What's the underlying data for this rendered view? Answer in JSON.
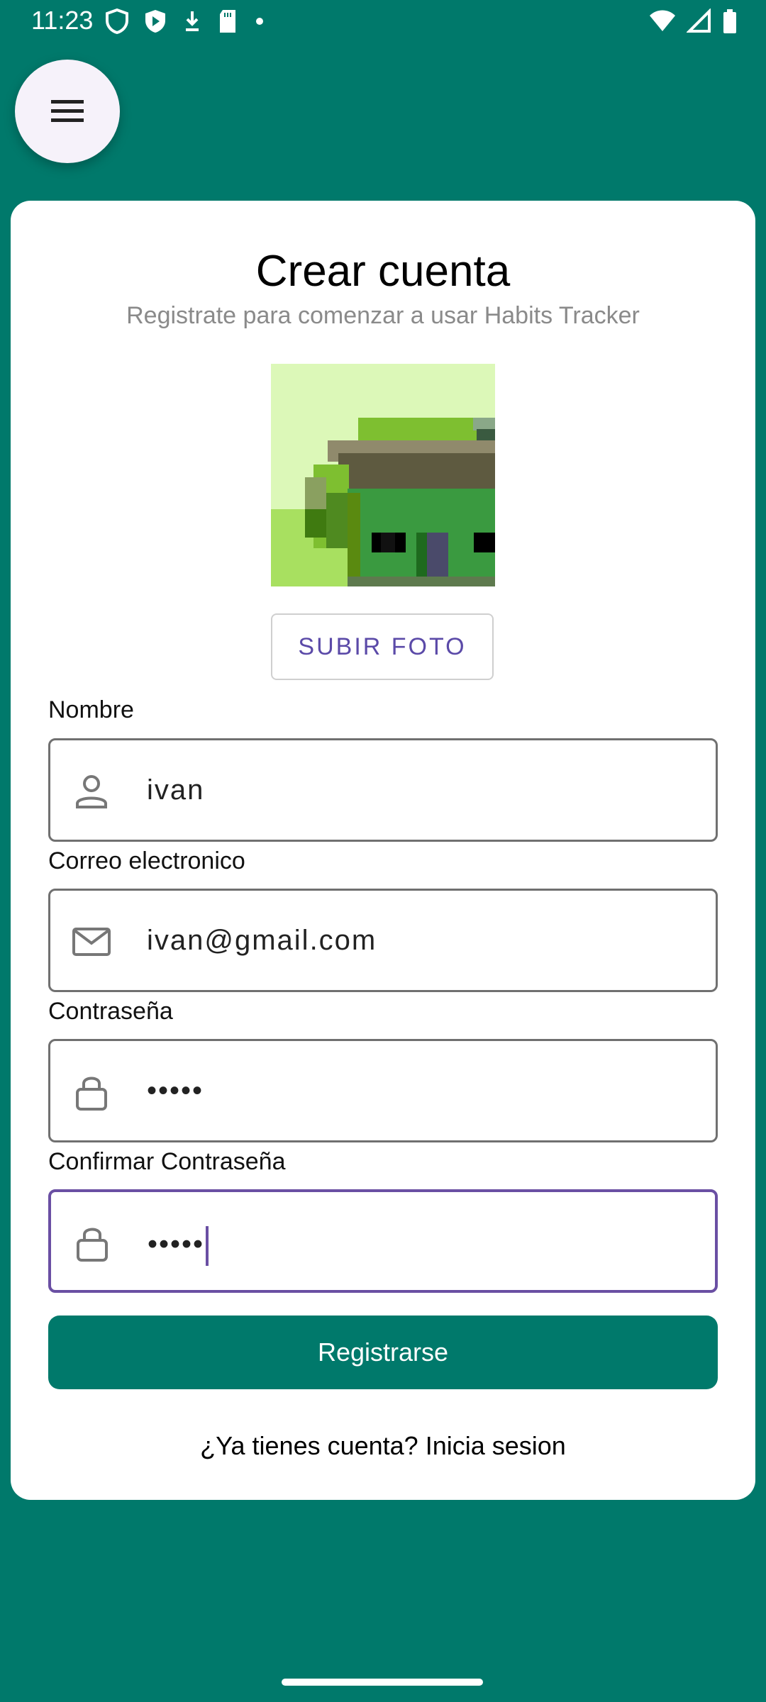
{
  "status_bar": {
    "time": "11:23",
    "left_icons": [
      "shield-icon",
      "play-protect-icon",
      "download-icon",
      "sd-card-icon",
      "dot-icon"
    ],
    "right_icons": [
      "wifi-icon",
      "signal-icon",
      "battery-icon"
    ]
  },
  "menu": {
    "icon": "hamburger-menu-icon"
  },
  "header": {
    "title": "Crear cuenta",
    "subtitle": "Registrate para comenzar a usar Habits Tracker"
  },
  "avatar": {
    "description_icon": "pixel-avatar"
  },
  "upload": {
    "label": "SUBIR FOTO"
  },
  "fields": {
    "name": {
      "label": "Nombre",
      "value": "ivan",
      "icon": "person-icon"
    },
    "email": {
      "label": "Correo electronico",
      "value": "ivan@gmail.com",
      "icon": "mail-icon"
    },
    "password": {
      "label": "Contraseña",
      "value": "•••••",
      "icon": "lock-icon"
    },
    "confirm": {
      "label": "Confirmar Contraseña",
      "value": "•••••",
      "icon": "lock-icon"
    }
  },
  "actions": {
    "register": "Registrarse",
    "login_link": "¿Ya tienes cuenta? Inicia sesion"
  },
  "colors": {
    "background": "#00796b",
    "accent": "#6a4fa3",
    "button": "#00796b"
  }
}
